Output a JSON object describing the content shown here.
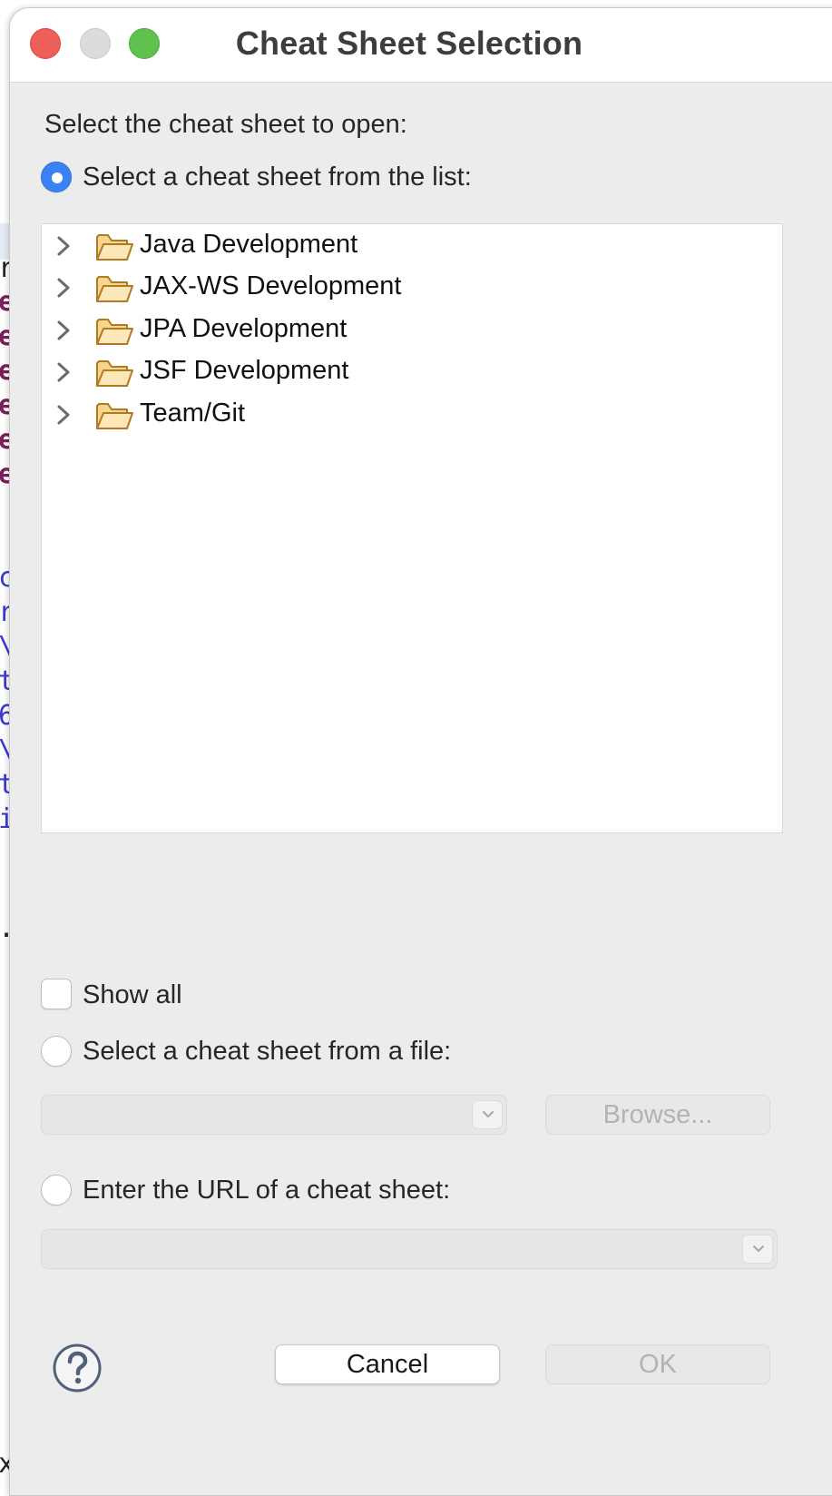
{
  "window": {
    "title": "Cheat Sheet Selection"
  },
  "dialog": {
    "prompt": "Select the cheat sheet to open:",
    "option_list_label": "Select a cheat sheet from the list:",
    "tree_items": [
      {
        "label": "Java Development",
        "icon": "folder-icon"
      },
      {
        "label": "JAX-WS Development",
        "icon": "folder-icon"
      },
      {
        "label": "JPA Development",
        "icon": "folder-icon"
      },
      {
        "label": "JSF Development",
        "icon": "folder-icon"
      },
      {
        "label": "Team/Git",
        "icon": "folder-icon"
      }
    ],
    "show_all_label": "Show all",
    "option_file_label": "Select a cheat sheet from a file:",
    "file_value": "",
    "browse_label": "Browse...",
    "option_url_label": "Enter the URL of a cheat sheet:",
    "url_value": "",
    "cancel_label": "Cancel",
    "ok_label": "OK"
  },
  "background_editor": {
    "visible_chars": [
      "r",
      "e",
      "e",
      "e",
      "e",
      "e",
      "e",
      "c",
      "r",
      "\\",
      "t",
      "6",
      "\\",
      "t",
      "i",
      ".",
      "x"
    ]
  },
  "colors": {
    "accent": "#3b82f6",
    "close": "#ed5f57",
    "minimize": "#dcdcdc",
    "maximize": "#5fc24f",
    "folder": "#e9b552"
  }
}
